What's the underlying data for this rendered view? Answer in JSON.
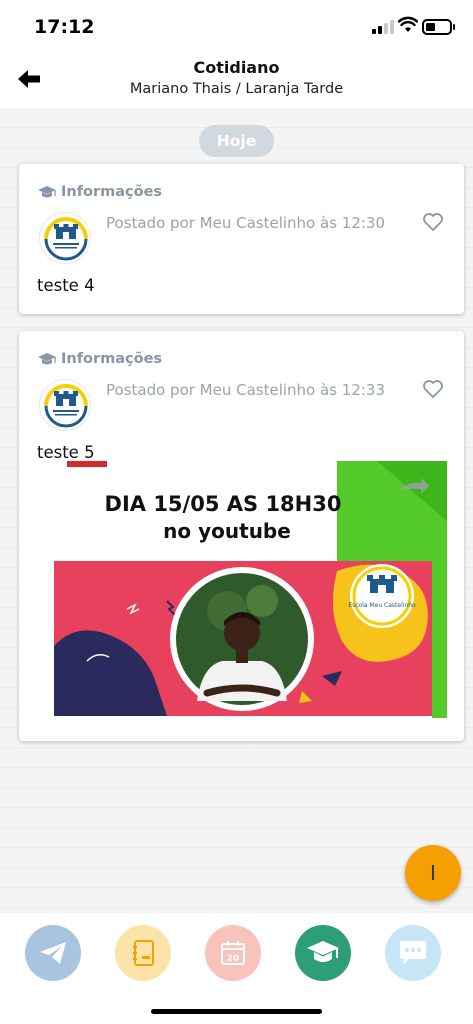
{
  "status_bar": {
    "time": "17:12"
  },
  "header": {
    "title": "Cotidiano",
    "subtitle": "Mariano Thais / Laranja Tarde"
  },
  "feed": {
    "day_label": "Hoje",
    "posts": [
      {
        "category": "Informações",
        "posted_by": "Postado por Meu Castelinho às 12:30",
        "text": "teste 4"
      },
      {
        "category": "Informações",
        "posted_by": "Postado por Meu Castelinho às 12:33",
        "text": "teste 5",
        "image": {
          "line1": "DIA 15/05 AS 18H30",
          "line2": "no youtube",
          "logo_text": "Escola Meu Castelinho"
        }
      }
    ]
  },
  "fab": {
    "label": "I"
  },
  "tabbar": {
    "items": [
      {
        "icon": "paper-plane-icon",
        "color": "#a8c4e0"
      },
      {
        "icon": "notebook-icon",
        "color": "#fce3a8"
      },
      {
        "icon": "calendar-icon",
        "color": "#f7c3bb",
        "badge": "20"
      },
      {
        "icon": "graduation-cap-icon",
        "color": "#2e9e7a"
      },
      {
        "icon": "chat-bubble-icon",
        "color": "#c6e5f7"
      }
    ]
  },
  "colors": {
    "accent": "#f5a000",
    "category_text": "#8796a6",
    "pill": "#d0d8e0",
    "banner_pink": "#e8415e",
    "banner_green": "#53c92a"
  }
}
